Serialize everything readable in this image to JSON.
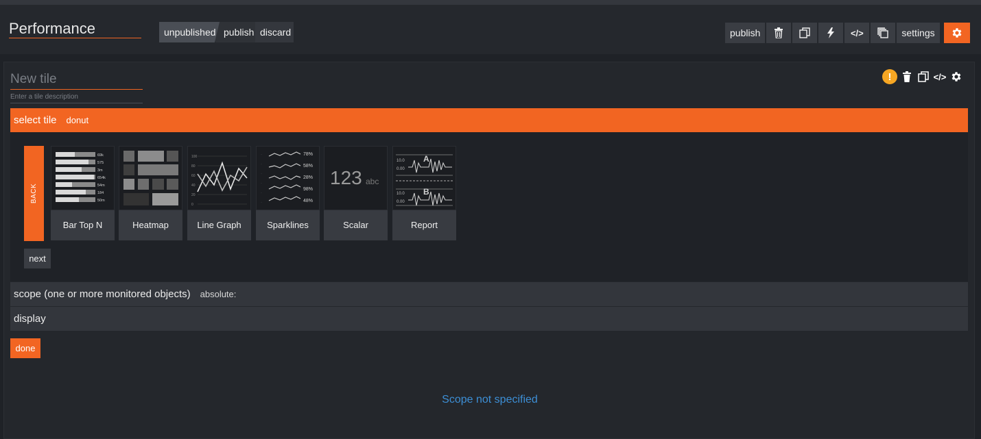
{
  "header": {
    "title": "Performance",
    "status": {
      "unpublished": "unpublished",
      "publish": "publish",
      "discard": "discard"
    },
    "toolbar": {
      "publish_label": "publish",
      "icons": [
        "trash-icon",
        "copy-icon",
        "lightning-icon",
        "code-icon",
        "clone-icon"
      ],
      "code_glyph": "</>",
      "settings_label": "settings"
    }
  },
  "tile": {
    "title_placeholder": "New tile",
    "description_placeholder": "Enter a tile description",
    "warning_glyph": "!",
    "code_glyph": "</>"
  },
  "select_tile": {
    "label": "select tile",
    "value": "donut"
  },
  "gallery": {
    "back_label": "BACK",
    "next_label": "next",
    "items": [
      {
        "name": "Bar Top N",
        "thumb_values": [
          "69k",
          "575",
          "3m",
          "654k",
          "54m",
          "184",
          "50m"
        ]
      },
      {
        "name": "Heatmap"
      },
      {
        "name": "Line Graph",
        "thumb_axis": [
          "100",
          "80",
          "60",
          "40",
          "20",
          "0"
        ]
      },
      {
        "name": "Sparklines",
        "thumb_values": [
          "78%",
          "58%",
          "28%",
          "98%",
          "48%"
        ]
      },
      {
        "name": "Scalar",
        "thumb_number": "123",
        "thumb_unit": "abc"
      },
      {
        "name": "Report",
        "thumb_values": [
          "10.0",
          "0.00",
          "10.0",
          "0.00"
        ],
        "thumb_letters": [
          "A",
          "B"
        ]
      }
    ]
  },
  "scope": {
    "label": "scope (one or more monitored objects)",
    "value": "absolute:"
  },
  "display": {
    "label": "display"
  },
  "done_label": "done",
  "message": "Scope not specified",
  "colors": {
    "accent": "#f26522",
    "background": "#1f2227",
    "link": "#3d8fd6",
    "warning": "#f6a623"
  }
}
